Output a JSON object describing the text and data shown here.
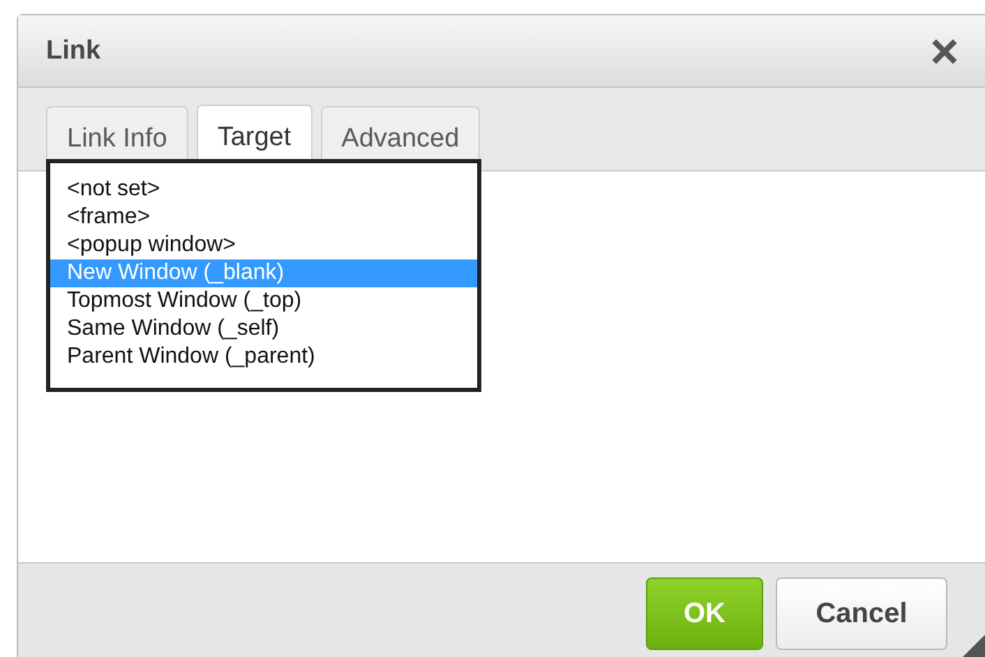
{
  "window": {
    "title": "Link"
  },
  "tabs": [
    {
      "label": "Link Info",
      "selected": false
    },
    {
      "label": "Target",
      "selected": true
    },
    {
      "label": "Advanced",
      "selected": false
    }
  ],
  "target_list": {
    "options": [
      {
        "label": "<not set>",
        "selected": false
      },
      {
        "label": "<frame>",
        "selected": false
      },
      {
        "label": "<popup window>",
        "selected": false
      },
      {
        "label": "New Window (_blank)",
        "selected": true
      },
      {
        "label": "Topmost Window (_top)",
        "selected": false
      },
      {
        "label": "Same Window (_self)",
        "selected": false
      },
      {
        "label": "Parent Window (_parent)",
        "selected": false
      }
    ]
  },
  "buttons": [
    {
      "label": "OK",
      "kind": "primary"
    },
    {
      "label": "Cancel",
      "kind": "secondary"
    }
  ]
}
